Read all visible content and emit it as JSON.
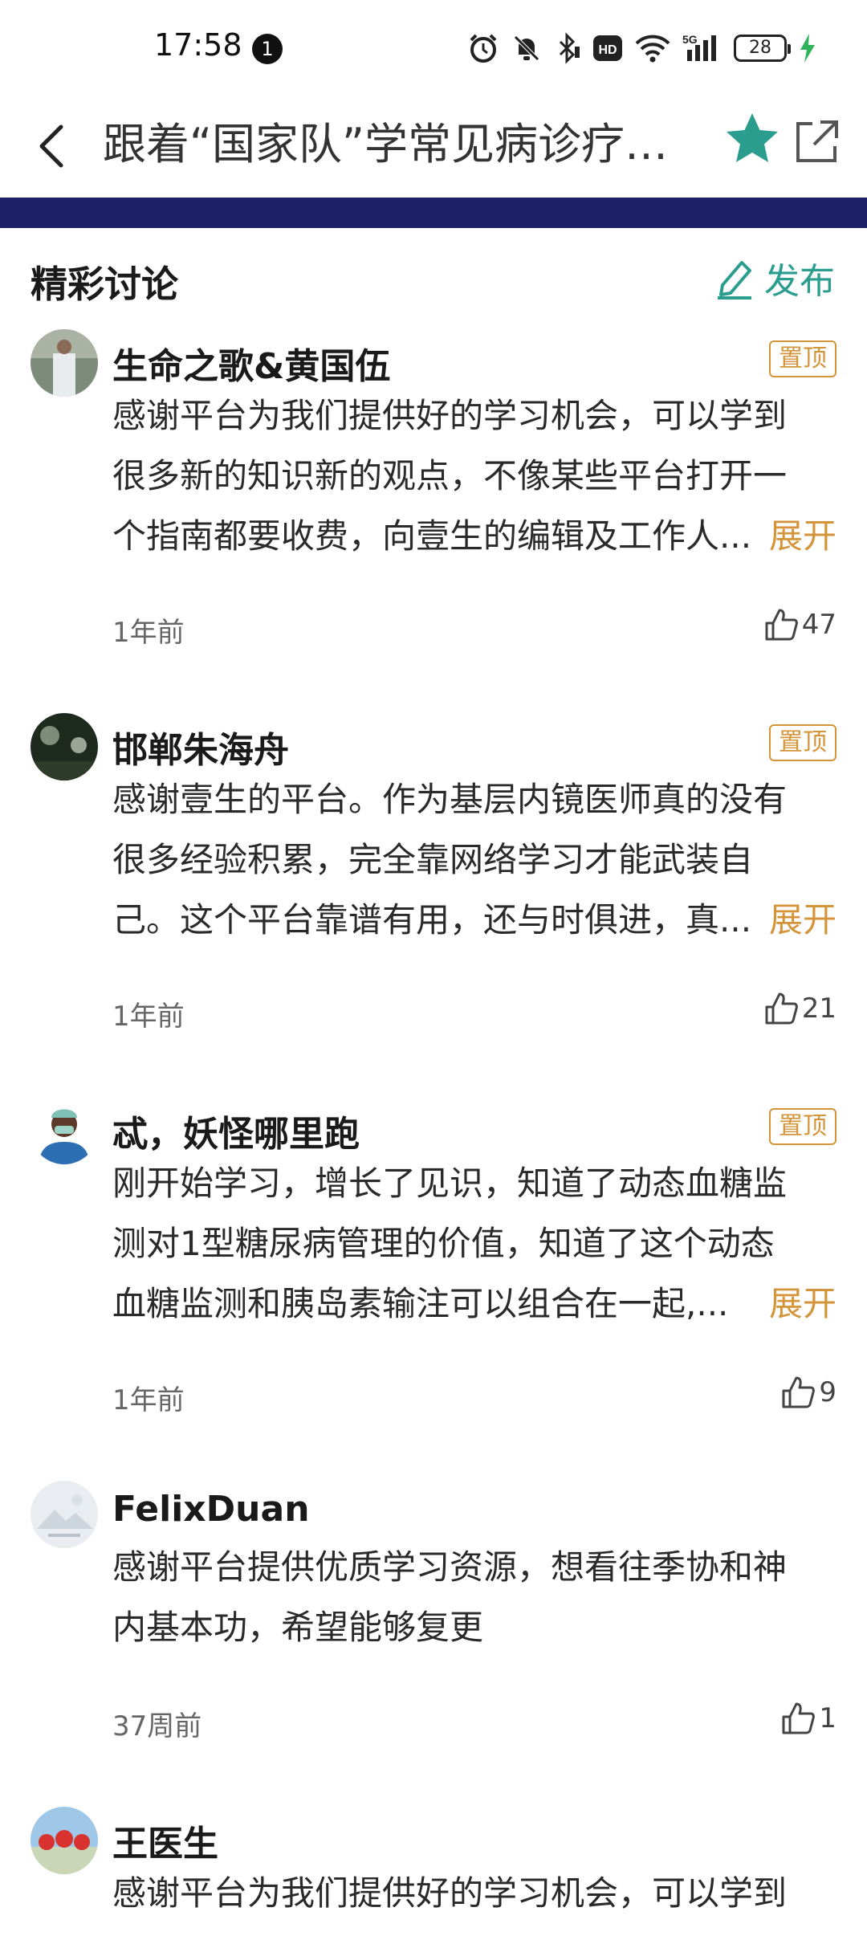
{
  "status": {
    "time": "17:58",
    "notification_count": "1",
    "battery": "28"
  },
  "header": {
    "title": "跟着“国家队”学常见病诊疗…"
  },
  "section": {
    "title": "精彩讨论",
    "publish_label": "发布",
    "expand_label": "展开"
  },
  "comments": [
    {
      "name": "生命之歌&黄国伍",
      "pinned_label": "置顶",
      "lines": [
        "感谢平台为我们提供好的学习机会，可以学到",
        "很多新的知识新的观点，不像某些平台打开一"
      ],
      "last_line": "个指南都要收费，向壹生的编辑及工作人...",
      "time": "1年前",
      "likes": "47"
    },
    {
      "name": "邯郸朱海舟",
      "pinned_label": "置顶",
      "lines": [
        "感谢壹生的平台。作为基层内镜医师真的没有",
        "很多经验积累，完全靠网络学习才能武装自"
      ],
      "last_line": "己。这个平台靠谱有用，还与时俱进，真...",
      "time": "1年前",
      "likes": "21"
    },
    {
      "name": "忒，妖怪哪里跑",
      "pinned_label": "置顶",
      "lines": [
        "刚开始学习，增长了见识，知道了动态血糖监",
        "测对1型糖尿病管理的价值，知道了这个动态"
      ],
      "last_line": "血糖监测和胰岛素输注可以组合在一起,...",
      "time": "1年前",
      "likes": "9"
    },
    {
      "name": "FelixDuan",
      "lines": [
        "感谢平台提供优质学习资源，想看往季协和神",
        "内基本功，希望能够复更"
      ],
      "time": "37周前",
      "likes": "1"
    },
    {
      "name": "王医生",
      "lines": [
        "感谢平台为我们提供好的学习机会，可以学到"
      ]
    }
  ],
  "colors": {
    "accent": "#2a9d8f",
    "pin": "#d4953a",
    "navy": "#1c2167"
  }
}
